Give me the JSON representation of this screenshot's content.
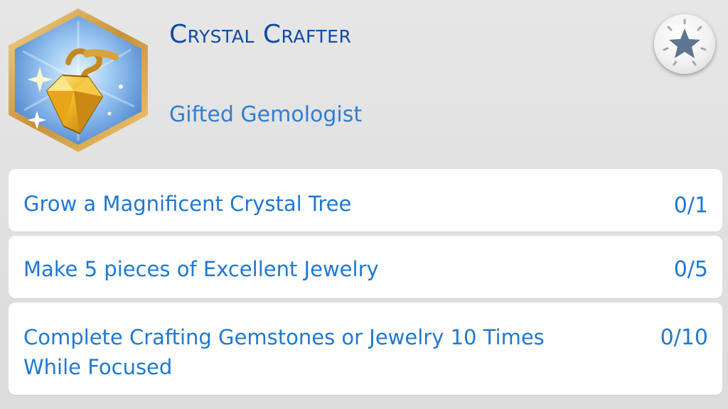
{
  "aspiration": {
    "title": "Crystal Crafter",
    "milestone": "Gifted Gemologist",
    "icon": "crystal-jewelry-badge-icon"
  },
  "star_button": {
    "icon": "star-icon"
  },
  "goals": [
    {
      "text": "Grow a Magnificent Crystal Tree",
      "progress": "0/1"
    },
    {
      "text": "Make 5 pieces of Excellent Jewelry",
      "progress": "0/5"
    },
    {
      "text": "Complete Crafting Gemstones or Jewelry 10 Times While Focused",
      "progress": "0/10"
    }
  ],
  "colors": {
    "title": "#0e4aa6",
    "text": "#1f78d1",
    "badge_border": "#d9a84a",
    "badge_fill": "#6aa7e6",
    "gem": "#f2b724"
  }
}
